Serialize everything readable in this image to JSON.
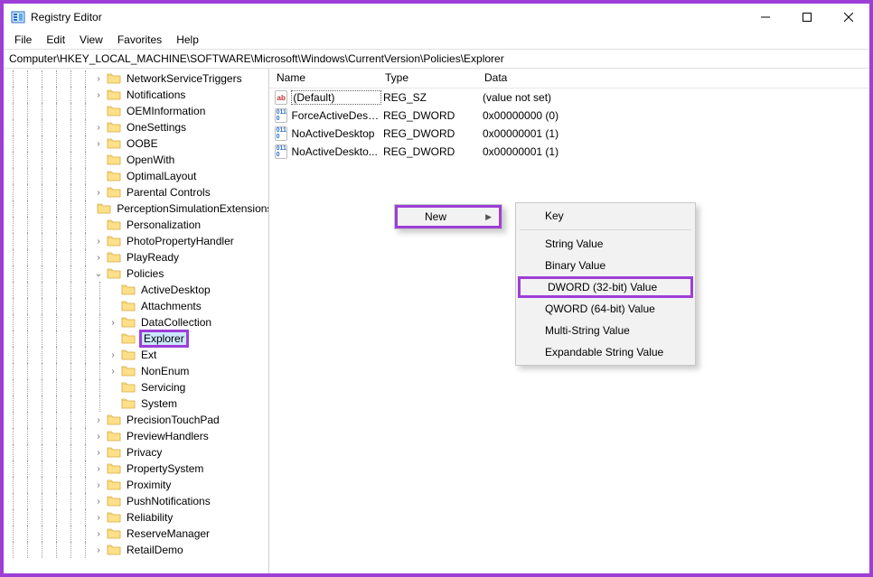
{
  "window": {
    "title": "Registry Editor"
  },
  "menubar": [
    "File",
    "Edit",
    "View",
    "Favorites",
    "Help"
  ],
  "address": "Computer\\HKEY_LOCAL_MACHINE\\SOFTWARE\\Microsoft\\Windows\\CurrentVersion\\Policies\\Explorer",
  "tree": [
    {
      "indent": 6,
      "exp": ">",
      "label": "NetworkServiceTriggers"
    },
    {
      "indent": 6,
      "exp": ">",
      "label": "Notifications"
    },
    {
      "indent": 6,
      "exp": "",
      "label": "OEMInformation"
    },
    {
      "indent": 6,
      "exp": ">",
      "label": "OneSettings"
    },
    {
      "indent": 6,
      "exp": ">",
      "label": "OOBE"
    },
    {
      "indent": 6,
      "exp": "",
      "label": "OpenWith"
    },
    {
      "indent": 6,
      "exp": "",
      "label": "OptimalLayout"
    },
    {
      "indent": 6,
      "exp": ">",
      "label": "Parental Controls"
    },
    {
      "indent": 6,
      "exp": "",
      "label": "PerceptionSimulationExtensions"
    },
    {
      "indent": 6,
      "exp": "",
      "label": "Personalization"
    },
    {
      "indent": 6,
      "exp": ">",
      "label": "PhotoPropertyHandler"
    },
    {
      "indent": 6,
      "exp": ">",
      "label": "PlayReady"
    },
    {
      "indent": 6,
      "exp": "v",
      "label": "Policies"
    },
    {
      "indent": 7,
      "exp": "",
      "label": "ActiveDesktop"
    },
    {
      "indent": 7,
      "exp": "",
      "label": "Attachments"
    },
    {
      "indent": 7,
      "exp": ">",
      "label": "DataCollection"
    },
    {
      "indent": 7,
      "exp": "",
      "label": "Explorer",
      "selected": true,
      "highlight": true
    },
    {
      "indent": 7,
      "exp": ">",
      "label": "Ext"
    },
    {
      "indent": 7,
      "exp": ">",
      "label": "NonEnum"
    },
    {
      "indent": 7,
      "exp": "",
      "label": "Servicing"
    },
    {
      "indent": 7,
      "exp": "",
      "label": "System"
    },
    {
      "indent": 6,
      "exp": ">",
      "label": "PrecisionTouchPad"
    },
    {
      "indent": 6,
      "exp": ">",
      "label": "PreviewHandlers"
    },
    {
      "indent": 6,
      "exp": ">",
      "label": "Privacy"
    },
    {
      "indent": 6,
      "exp": ">",
      "label": "PropertySystem"
    },
    {
      "indent": 6,
      "exp": ">",
      "label": "Proximity"
    },
    {
      "indent": 6,
      "exp": ">",
      "label": "PushNotifications"
    },
    {
      "indent": 6,
      "exp": ">",
      "label": "Reliability"
    },
    {
      "indent": 6,
      "exp": ">",
      "label": "ReserveManager"
    },
    {
      "indent": 6,
      "exp": ">",
      "label": "RetailDemo"
    }
  ],
  "columns": {
    "name": "Name",
    "type": "Type",
    "data": "Data"
  },
  "values": [
    {
      "icon": "sz",
      "name": "(Default)",
      "type": "REG_SZ",
      "data": "(value not set)",
      "selected": true
    },
    {
      "icon": "bin",
      "name": "ForceActiveDesk...",
      "type": "REG_DWORD",
      "data": "0x00000000 (0)"
    },
    {
      "icon": "bin",
      "name": "NoActiveDesktop",
      "type": "REG_DWORD",
      "data": "0x00000001 (1)"
    },
    {
      "icon": "bin",
      "name": "NoActiveDeskto...",
      "type": "REG_DWORD",
      "data": "0x00000001 (1)"
    }
  ],
  "context_primary": {
    "label": "New",
    "highlight": true
  },
  "context_sub": [
    {
      "label": "Key",
      "sep_after": true
    },
    {
      "label": "String Value"
    },
    {
      "label": "Binary Value"
    },
    {
      "label": "DWORD (32-bit) Value",
      "highlight": true
    },
    {
      "label": "QWORD (64-bit) Value"
    },
    {
      "label": "Multi-String Value"
    },
    {
      "label": "Expandable String Value"
    }
  ]
}
